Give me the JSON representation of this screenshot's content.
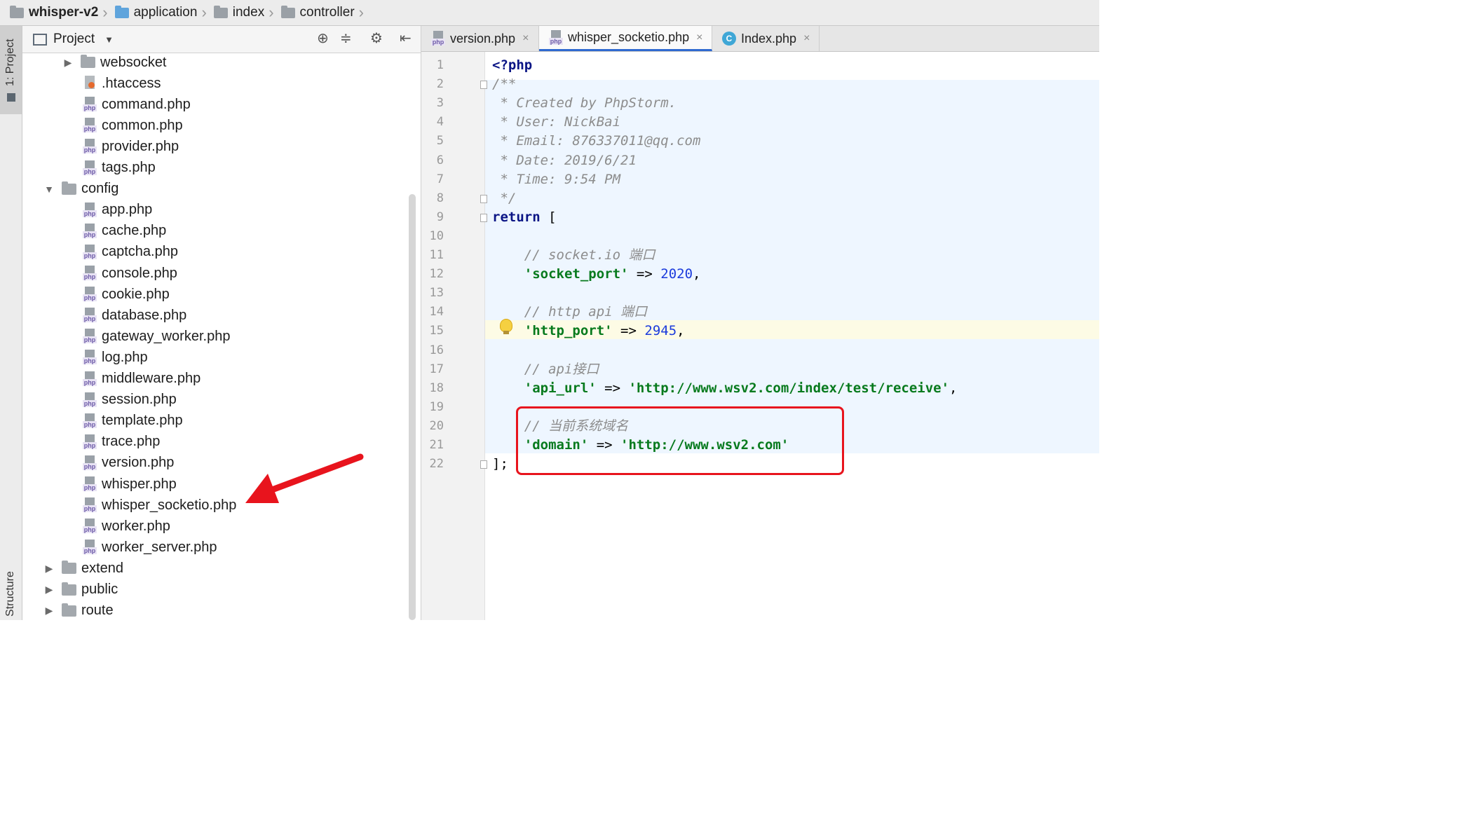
{
  "breadcrumb": [
    "whisper-v2",
    "application",
    "index",
    "controller"
  ],
  "toolwindows": {
    "left_top": "1: Project",
    "left_bottom": "Structure"
  },
  "project_panel": {
    "title": "Project"
  },
  "tree": [
    {
      "label": "websocket",
      "type": "folder",
      "expanded": false
    },
    {
      "label": ".htaccess",
      "type": "htaccess"
    },
    {
      "label": "command.php",
      "type": "php"
    },
    {
      "label": "common.php",
      "type": "php"
    },
    {
      "label": "provider.php",
      "type": "php"
    },
    {
      "label": "tags.php",
      "type": "php"
    },
    {
      "label": "config",
      "type": "folder",
      "expanded": true
    },
    {
      "label": "app.php",
      "type": "php"
    },
    {
      "label": "cache.php",
      "type": "php"
    },
    {
      "label": "captcha.php",
      "type": "php"
    },
    {
      "label": "console.php",
      "type": "php"
    },
    {
      "label": "cookie.php",
      "type": "php"
    },
    {
      "label": "database.php",
      "type": "php"
    },
    {
      "label": "gateway_worker.php",
      "type": "php"
    },
    {
      "label": "log.php",
      "type": "php"
    },
    {
      "label": "middleware.php",
      "type": "php"
    },
    {
      "label": "session.php",
      "type": "php"
    },
    {
      "label": "template.php",
      "type": "php"
    },
    {
      "label": "trace.php",
      "type": "php"
    },
    {
      "label": "version.php",
      "type": "php"
    },
    {
      "label": "whisper.php",
      "type": "php"
    },
    {
      "label": "whisper_socketio.php",
      "type": "php"
    },
    {
      "label": "worker.php",
      "type": "php"
    },
    {
      "label": "worker_server.php",
      "type": "php"
    },
    {
      "label": "extend",
      "type": "folder",
      "expanded": false
    },
    {
      "label": "public",
      "type": "folder",
      "expanded": false
    },
    {
      "label": "route",
      "type": "folder",
      "expanded": false
    }
  ],
  "tabs": [
    {
      "label": "version.php",
      "icon": "php"
    },
    {
      "label": "whisper_socketio.php",
      "icon": "php",
      "active": true
    },
    {
      "label": "Index.php",
      "icon": "C"
    }
  ],
  "file_type_tag": "php",
  "class_icon_letter": "C",
  "close_glyph": "×",
  "code_lines": [
    "<?php",
    "/**",
    " * Created by PhpStorm.",
    " * User: NickBai",
    " * Email: 876337011@qq.com",
    " * Date: 2019/6/21",
    " * Time: 9:54 PM",
    " */",
    "return [",
    "",
    "    // socket.io 端口",
    "    'socket_port' => 2020,",
    "",
    "    // http api 端口",
    "    'http_port' => 2945,",
    "",
    "    // api接口",
    "    'api_url' => 'http://www.wsv2.com/index/test/receive',",
    "",
    "    // 当前系统域名",
    "    'domain' => 'http://www.wsv2.com'",
    "];"
  ],
  "current_line": 15,
  "colors": {
    "highlight_box": "#e8141d",
    "arrow": "#e8141d",
    "keyword": "#0b1585",
    "string": "#077a1d",
    "number": "#1b3bdc",
    "comment": "#8c8c8c"
  }
}
